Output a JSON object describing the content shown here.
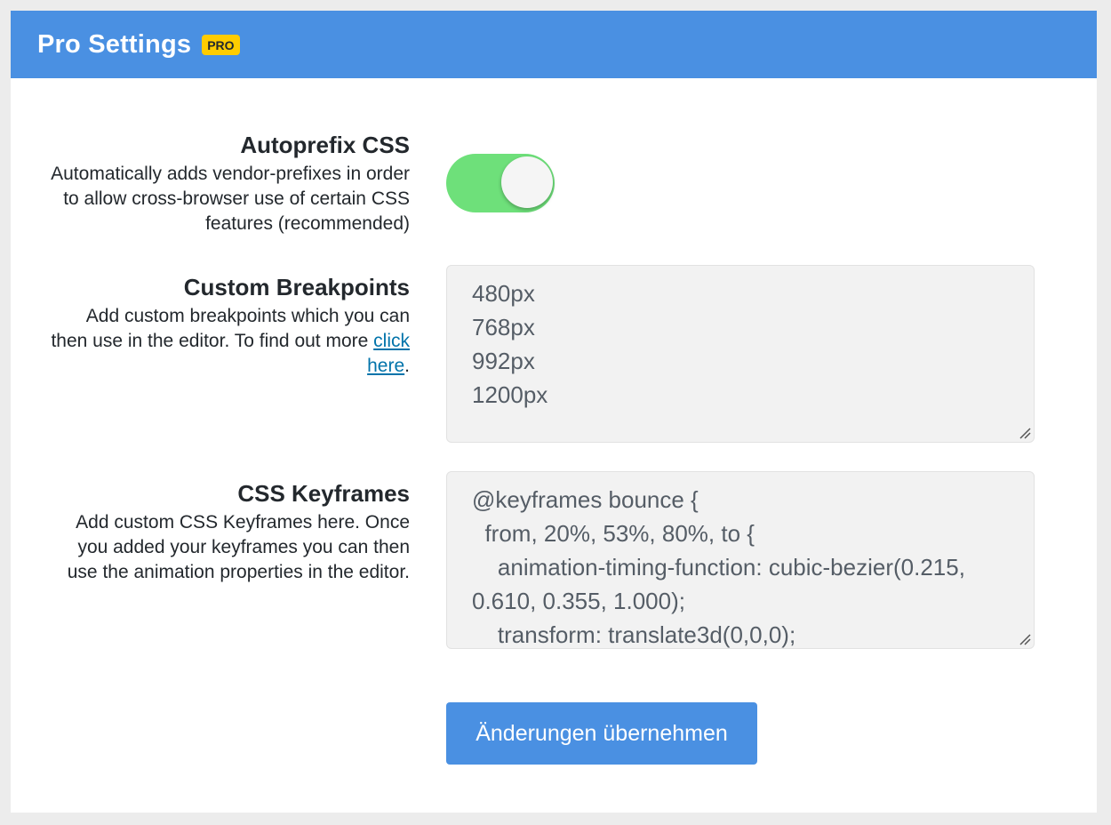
{
  "header": {
    "title": "Pro Settings",
    "badge": "PRO"
  },
  "autoprefix": {
    "title": "Autoprefix CSS",
    "description": "Automatically adds vendor-prefixes in order to allow cross-browser use of certain CSS features (recommended)",
    "toggle_on": true,
    "toggle_color": "#6ee07a"
  },
  "breakpoints": {
    "title": "Custom Breakpoints",
    "description_before": "Add custom breakpoints which you can then use in the editor. To find out more ",
    "link_text": "click here",
    "description_after": ".",
    "value": "480px\n768px\n992px\n1200px"
  },
  "keyframes": {
    "title": "CSS Keyframes",
    "description": "Add custom CSS Keyframes here. Once you added your keyframes you can then use the animation properties in the editor.",
    "value": "@keyframes bounce {\n  from, 20%, 53%, 80%, to {\n    animation-timing-function: cubic-bezier(0.215, 0.610, 0.355, 1.000);\n    transform: translate3d(0,0,0);"
  },
  "submit": {
    "label": "Änderungen übernehmen"
  },
  "colors": {
    "accent": "#4a90e2",
    "badge": "#ffcc00",
    "link": "#0073aa"
  }
}
